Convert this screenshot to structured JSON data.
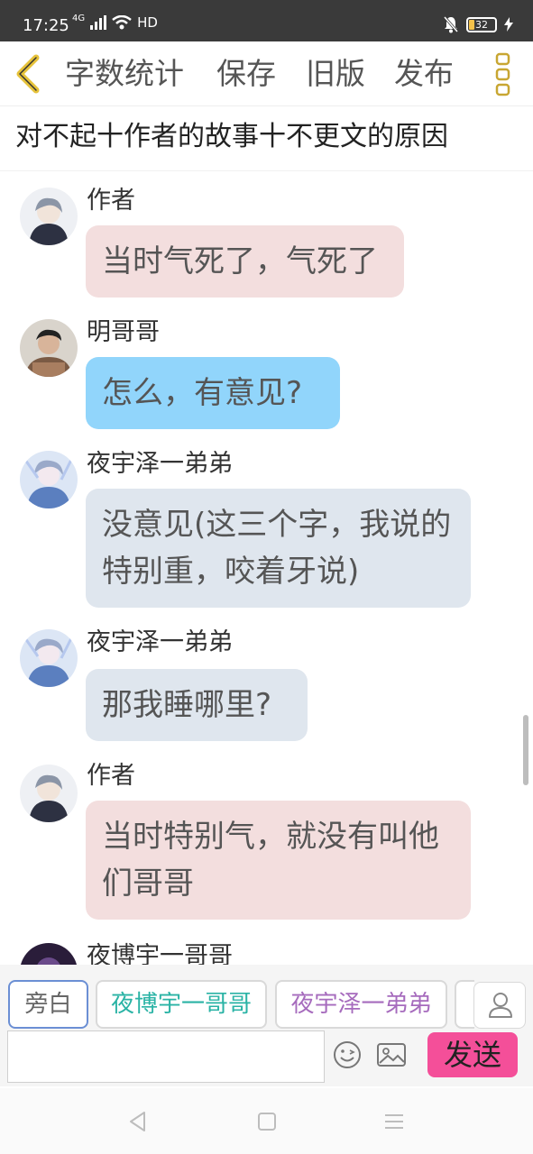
{
  "status_bar": {
    "time": "17:25",
    "network": "4G",
    "hd": "HD",
    "battery": "32"
  },
  "toolbar": {
    "word_count": "字数统计",
    "save": "保存",
    "old_version": "旧版",
    "publish": "发布"
  },
  "document": {
    "title": "对不起十作者的故事十不更文的原因"
  },
  "messages": [
    {
      "speaker": "作者",
      "text": "当时气死了，气死了",
      "style": "pink"
    },
    {
      "speaker": "明哥哥",
      "text": "怎么，有意见?",
      "style": "blue"
    },
    {
      "speaker": "夜宇泽一弟弟",
      "text": "没意见(这三个字，我说的特别重，咬着牙说)",
      "style": "gray"
    },
    {
      "speaker": "夜宇泽一弟弟",
      "text": "那我睡哪里?",
      "style": "gray"
    },
    {
      "speaker": "作者",
      "text": "当时特别气，就没有叫他们哥哥",
      "style": "pink"
    },
    {
      "speaker": "夜博宇一哥哥",
      "text": "",
      "style": "gray"
    }
  ],
  "roles": [
    {
      "label": "旁白",
      "selected": true
    },
    {
      "label": "夜博宇一哥哥",
      "selected": false
    },
    {
      "label": "夜宇泽一弟弟",
      "selected": false
    }
  ],
  "composer": {
    "input_value": "",
    "send_label": "发送"
  },
  "colors": {
    "accent_yellow": "#e6c23a",
    "send_pink": "#f44f99",
    "bubble_pink": "#f3dede",
    "bubble_blue": "#91d5fb",
    "bubble_gray": "#dfe6ee"
  }
}
